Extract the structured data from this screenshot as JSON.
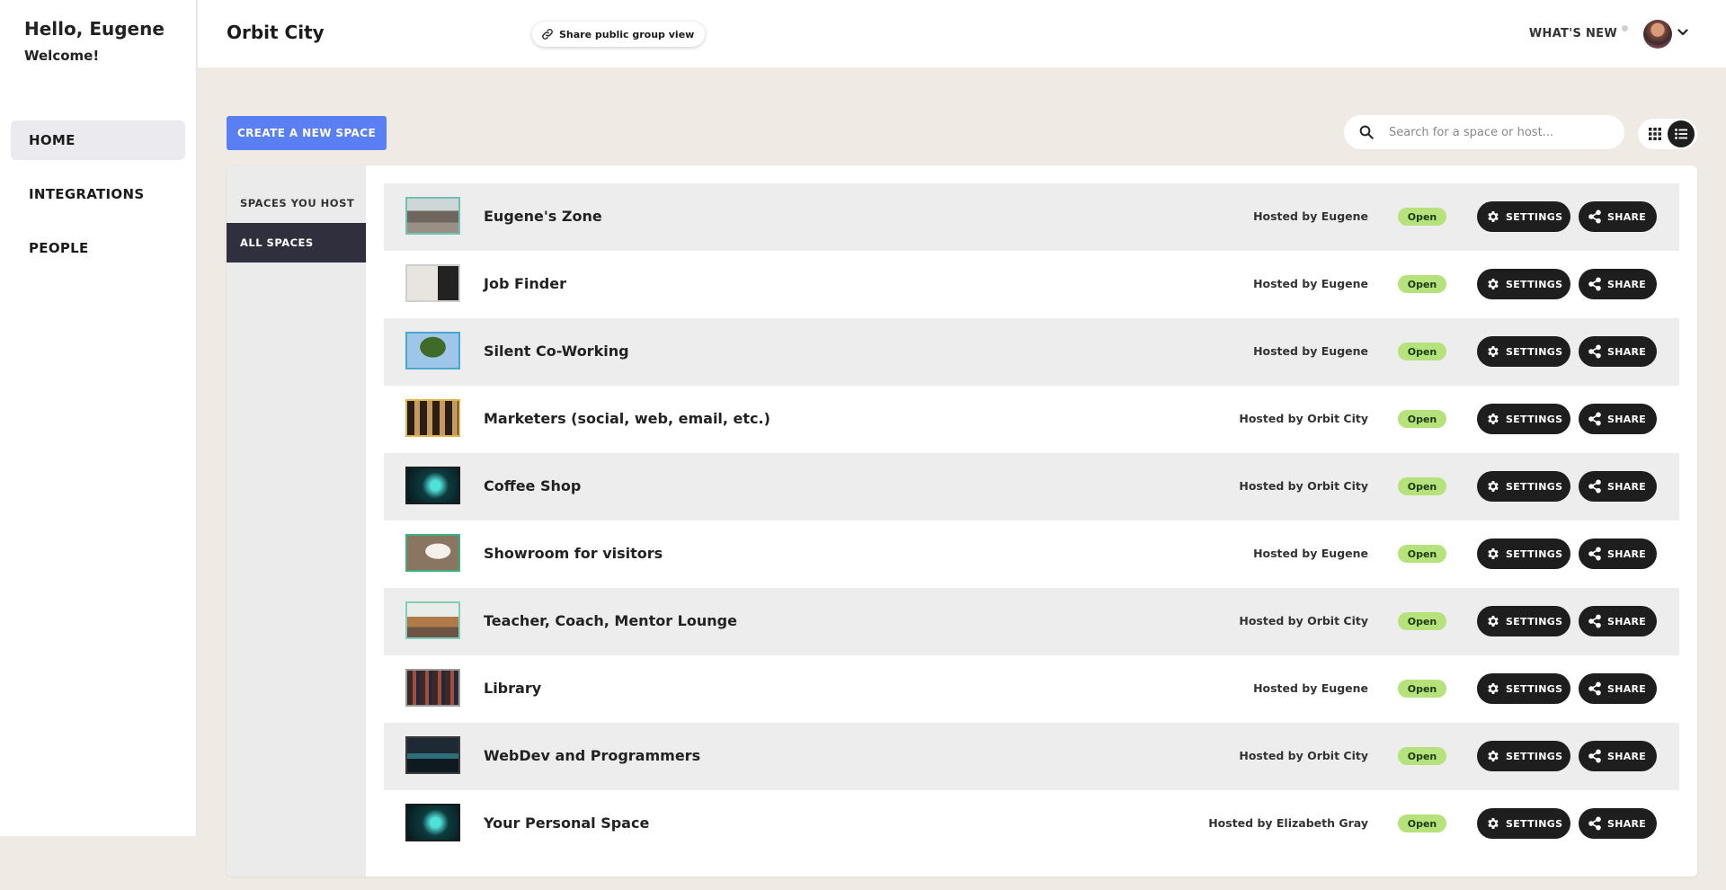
{
  "sidebar": {
    "greeting": "Hello, Eugene",
    "welcome": "Welcome!",
    "nav": [
      {
        "label": "HOME",
        "icon": "home",
        "active": true
      },
      {
        "label": "INTEGRATIONS",
        "icon": "integrations",
        "active": false
      },
      {
        "label": "PEOPLE",
        "icon": "people",
        "active": false
      }
    ]
  },
  "header": {
    "title": "Orbit City",
    "share_public_label": "Share public group view",
    "whats_new_label": "WHAT'S NEW"
  },
  "toolbar": {
    "create_label": "CREATE A NEW SPACE",
    "search_placeholder": "Search for a space or host...",
    "search_value": "",
    "view_mode": "list"
  },
  "filters": [
    {
      "label": "SPACES YOU HOST",
      "active": false
    },
    {
      "label": "ALL SPACES",
      "active": true
    }
  ],
  "spaces": [
    {
      "name": "Eugene's Zone",
      "host": "Hosted by Eugene",
      "status": "Open",
      "settings_label": "SETTINGS",
      "share_label": "SHARE"
    },
    {
      "name": "Job Finder",
      "host": "Hosted by Eugene",
      "status": "Open",
      "settings_label": "SETTINGS",
      "share_label": "SHARE"
    },
    {
      "name": "Silent Co-Working",
      "host": "Hosted by Eugene",
      "status": "Open",
      "settings_label": "SETTINGS",
      "share_label": "SHARE"
    },
    {
      "name": "Marketers (social, web, email, etc.)",
      "host": "Hosted by Orbit City",
      "status": "Open",
      "settings_label": "SETTINGS",
      "share_label": "SHARE"
    },
    {
      "name": "Coffee Shop",
      "host": "Hosted by Orbit City",
      "status": "Open",
      "settings_label": "SETTINGS",
      "share_label": "SHARE"
    },
    {
      "name": "Showroom for visitors",
      "host": "Hosted by Eugene",
      "status": "Open",
      "settings_label": "SETTINGS",
      "share_label": "SHARE"
    },
    {
      "name": "Teacher, Coach, Mentor Lounge",
      "host": "Hosted by Orbit City",
      "status": "Open",
      "settings_label": "SETTINGS",
      "share_label": "SHARE"
    },
    {
      "name": "Library",
      "host": "Hosted by Eugene",
      "status": "Open",
      "settings_label": "SETTINGS",
      "share_label": "SHARE"
    },
    {
      "name": "WebDev and Programmers",
      "host": "Hosted by Orbit City",
      "status": "Open",
      "settings_label": "SETTINGS",
      "share_label": "SHARE"
    },
    {
      "name": "Your Personal Space",
      "host": "Hosted by Elizabeth Gray",
      "status": "Open",
      "settings_label": "SETTINGS",
      "share_label": "SHARE"
    }
  ],
  "colors": {
    "accent": "#5a7ff2",
    "dark_button": "#1e1e1e",
    "status_open": "#b5e27a",
    "background": "#efeae3",
    "active_filter": "#2f2f3d"
  }
}
